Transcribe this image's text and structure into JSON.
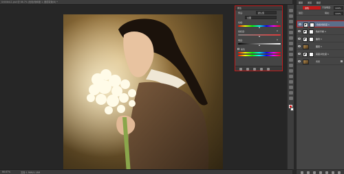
{
  "window": {
    "doc_tab": "Untitled-1.psd @ 66.7% (色相/饱和度 1, 图层蒙版/8) *"
  },
  "status": {
    "zoom": "66.67%",
    "doc_info": "文档:1.36M/4.18M"
  },
  "properties": {
    "title": "属性",
    "preset_label": "预设:",
    "preset_value": "默认值",
    "channel_value": "全图",
    "hue_label": "色相:",
    "hue_value": "0",
    "saturation_label": "饱和度:",
    "saturation_value": "0",
    "lightness_label": "明度:",
    "lightness_value": "0",
    "colorize_label": "着色"
  },
  "layers_panel": {
    "tabs": [
      "图层",
      "通道",
      "路径"
    ],
    "blend_mode": "滤色",
    "opacity_label": "不透明度:",
    "opacity_value": "100%",
    "fill_label": "填充:",
    "fill_value": "100%",
    "lock_label": "锁定:",
    "layers": [
      {
        "name": "色相/饱和度 1",
        "type": "adjustment",
        "selected": true
      },
      {
        "name": "色彩平衡 1",
        "type": "adjustment",
        "selected": false
      },
      {
        "name": "曲线 1",
        "type": "adjustment",
        "selected": false
      },
      {
        "name": "图层 1",
        "type": "pixel",
        "selected": false
      },
      {
        "name": "亮度/对比度 1",
        "type": "adjustment",
        "selected": false
      },
      {
        "name": "背景",
        "type": "pixel",
        "selected": false
      }
    ]
  },
  "colors": {
    "highlight_border": "#c21a1a",
    "foreground_swatch": "#d21616",
    "background_swatch": "#ffffff",
    "selected_layer": "#5b6f8b"
  },
  "icons": [
    "eye-icon",
    "adjustment-layer-icon",
    "layer-mask-icon",
    "lock-icon",
    "move-tool-icon",
    "brush-tool-icon",
    "eraser-tool-icon",
    "zoom-tool-icon"
  ]
}
